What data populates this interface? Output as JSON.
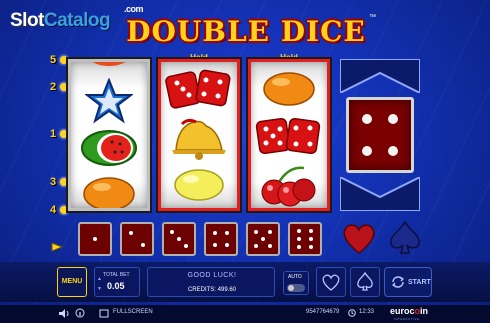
{
  "watermark": {
    "slot": "Slot",
    "catalog": "Catalog",
    "com": ".com"
  },
  "game": {
    "title": "DOUBLE DICE",
    "trademark": "™",
    "line_numbers": {
      "top": "5",
      "upper": "2",
      "middle": "1",
      "lower": "3",
      "bottom": "4"
    },
    "reels": [
      {
        "name": "reel-1",
        "held": false,
        "symbols": [
          "star",
          "watermelon",
          "orange"
        ]
      },
      {
        "name": "reel-2",
        "held": true,
        "hold_label": "Hold",
        "symbols": [
          "red-dice",
          "bell",
          "lemon"
        ]
      },
      {
        "name": "reel-3",
        "held": true,
        "hold_label": "Hold",
        "symbols": [
          "orange",
          "red-dice",
          "cherries"
        ]
      }
    ],
    "dice_reel": {
      "face": 4
    },
    "mini_dice": [
      1,
      2,
      3,
      4,
      5,
      6
    ],
    "suits": [
      "heart",
      "spade"
    ],
    "colors": {
      "accent": "#ffd21e",
      "hold_border": "#e31e1e",
      "die": "#7a0000"
    }
  },
  "controls": {
    "menu_label": "MENU",
    "total_bet_label": "TOTAL BET",
    "total_bet_value": "0.05",
    "message": "GOOD LUCK!",
    "credits_label": "CREDITS:",
    "credits_value": "499.60",
    "auto_label": "AUTO",
    "start_label": "START"
  },
  "status_bar": {
    "fullscreen_label": "FULLSCREEN",
    "session_id": "9547764679",
    "time": "12:33",
    "brand_prefix": "euroc",
    "brand_o": "o",
    "brand_suffix": "in",
    "brand_sub": "INTERACTIVE"
  }
}
